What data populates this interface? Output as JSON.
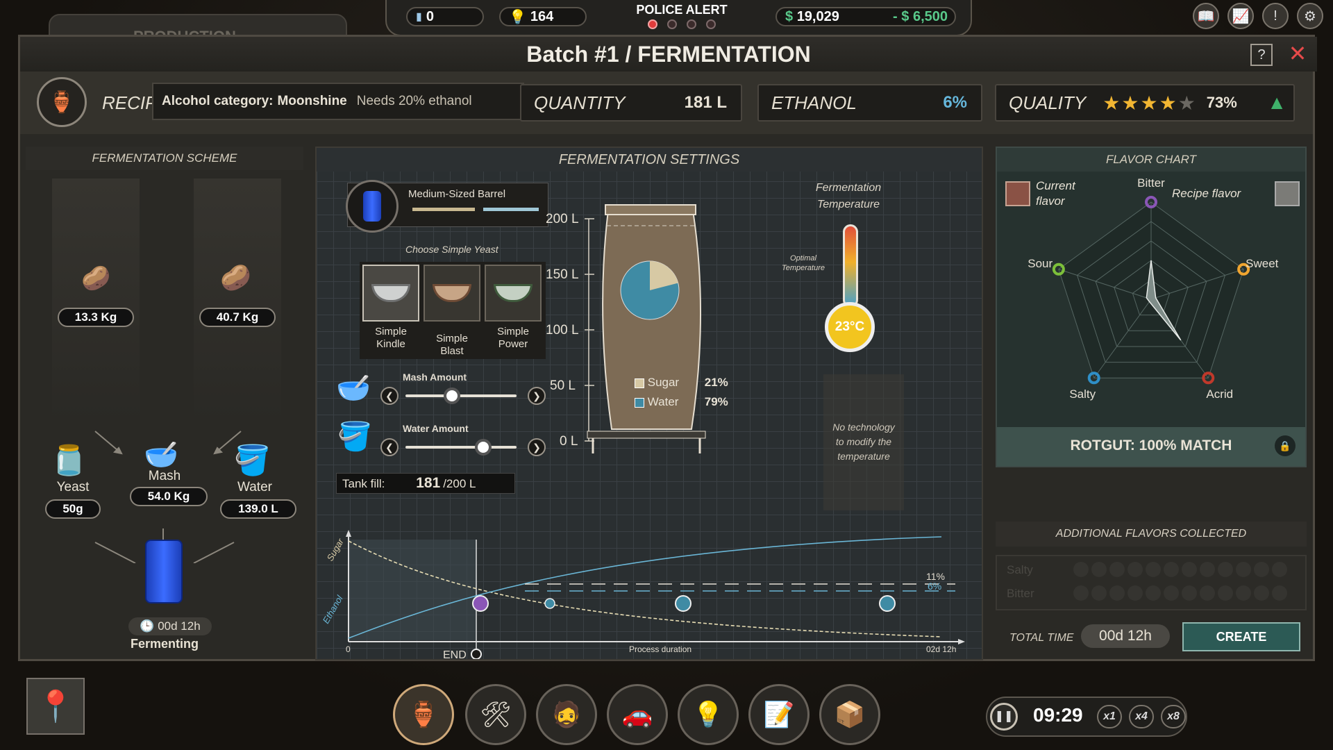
{
  "topbar": {
    "cans": "0",
    "bulbs": "164",
    "police_alert": "POLICE ALERT",
    "money": "19,029",
    "money_currency": "$",
    "expense": "- $ 6,500"
  },
  "tab_behind": "PRODUCTION",
  "window": {
    "title": "Batch #1 / FERMENTATION",
    "help": "?",
    "close": "✕"
  },
  "header": {
    "recipe_label": "RECIPE",
    "category_label": "Alcohol category:",
    "category_value": "Moonshine",
    "needs": "Needs 20% ethanol",
    "quantity_label": "QUANTITY",
    "quantity_value": "181 L",
    "ethanol_label": "ETHANOL",
    "ethanol_value": "6%",
    "quality_label": "QUALITY",
    "quality_value": "73%",
    "quality_stars": 4
  },
  "scheme": {
    "title": "FERMENTATION SCHEME",
    "input1_weight": "13.3 Kg",
    "input2_weight": "40.7 Kg",
    "yeast_label": "Yeast",
    "yeast_value": "50g",
    "mash_label": "Mash",
    "mash_value": "54.0 Kg",
    "water_label": "Water",
    "water_value": "139.0 L",
    "timer": "00d 12h",
    "status": "Fermenting"
  },
  "settings": {
    "title": "FERMENTATION SETTINGS",
    "barrel_name": "Medium-Sized Barrel",
    "choose_yeast": "Choose Simple Yeast",
    "yeasts": [
      {
        "line1": "Simple",
        "line2": "Kindle"
      },
      {
        "line1": "Simple Blast",
        "line2": ""
      },
      {
        "line1": "Simple",
        "line2": "Power"
      }
    ],
    "mash_amount_label": "Mash Amount",
    "water_amount_label": "Water Amount",
    "mash_slider": 0.42,
    "water_slider": 0.7,
    "tank_fill_label": "Tank fill:",
    "tank_fill_value": "181",
    "tank_fill_max": "/200 L",
    "axis_ticks": [
      "200 L",
      "150 L",
      "100 L",
      "50 L",
      "0 L"
    ],
    "sugar_label": "Sugar",
    "sugar_pct": "21%",
    "water_label": "Water",
    "water_pct": "79%",
    "temp_title_1": "Fermentation",
    "temp_title_2": "Temperature",
    "optimal_1": "Optimal",
    "optimal_2": "Temperature",
    "temp_value": "23°C",
    "no_tech_1": "No technology",
    "no_tech_2": "to modify the",
    "no_tech_3": "temperature"
  },
  "process_chart": {
    "sugar_axis": "Sugar",
    "ethanol_axis": "Ethanol",
    "origin": "0",
    "end_label": "END",
    "x_label": "Process duration",
    "x_end": "02d 12h",
    "label_11": "11%",
    "label_6": "6%"
  },
  "flavor": {
    "title": "FLAVOR CHART",
    "current_1": "Current",
    "current_2": "flavor",
    "recipe_flavor": "Recipe flavor",
    "axes": [
      "Bitter",
      "Sweet",
      "Acrid",
      "Salty",
      "Sour"
    ],
    "current_values": {
      "Bitter": 0.4,
      "Sweet": 0.05,
      "Acrid": 0.52,
      "Salty": 0.03,
      "Sour": 0.05
    },
    "match": "ROTGUT: 100% MATCH"
  },
  "additional": {
    "title": "ADDITIONAL FLAVORS COLLECTED",
    "row1": "Salty",
    "row2": "Bitter"
  },
  "footer": {
    "total_time_label": "TOTAL TIME",
    "total_time_value": "00d 12h",
    "create": "CREATE"
  },
  "bottombar": {
    "clock": "09:29",
    "speeds": [
      "x1",
      "x4",
      "x8"
    ]
  }
}
